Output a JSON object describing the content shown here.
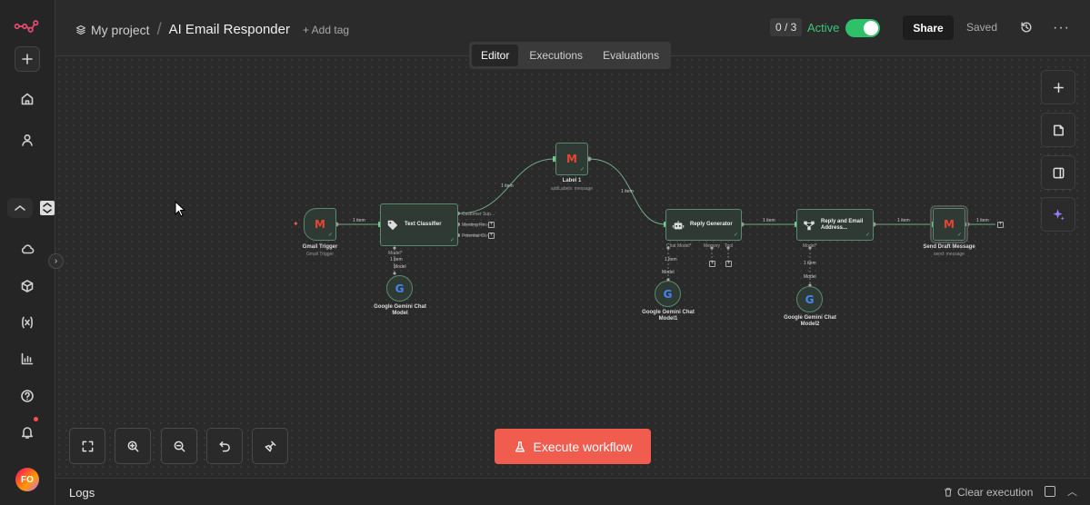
{
  "header": {
    "project": "My project",
    "separator": "/",
    "title": "AI Email Responder",
    "add_tag": "+ Add tag",
    "counter": "0 / 3",
    "active_label": "Active",
    "share": "Share",
    "saved": "Saved",
    "more": "···"
  },
  "tabs": [
    "Editor",
    "Executions",
    "Evaluations"
  ],
  "nodes": {
    "gmail_trigger": {
      "title": "Gmail Trigger",
      "sub": "Gmail Trigger"
    },
    "text_classifier": {
      "title": "Text Classifier",
      "outputs": [
        "Customer Sup...",
        "Meeting Re...",
        "Potential Cl..."
      ],
      "model_label": "Model*"
    },
    "gemini1": {
      "title": "Google Gemini Chat Model"
    },
    "label1": {
      "title": "Label 1",
      "sub": "addLabels: message"
    },
    "reply_generator": {
      "title": "Reply Generator",
      "ports": [
        "Chat Model*",
        "Memory",
        "Tool"
      ]
    },
    "gemini2": {
      "title": "Google Gemini Chat Model1"
    },
    "reply_email": {
      "title": "Reply and Email Address...",
      "ports": [
        "Model*"
      ]
    },
    "gemini3": {
      "title": "Google Gemini Chat Model2"
    },
    "send_draft": {
      "title": "Send Draft Message",
      "sub": "send: message"
    }
  },
  "edge_labels": {
    "item": "1 item",
    "model": "Model"
  },
  "execute": "Execute workflow",
  "logs": {
    "title": "Logs",
    "clear": "Clear execution"
  },
  "user": {
    "initials": "FO"
  },
  "colors": {
    "accent": "#f05d4f",
    "active_green": "#2fc16a",
    "node_border": "#5a8a6c",
    "edge": "#6fae86"
  }
}
